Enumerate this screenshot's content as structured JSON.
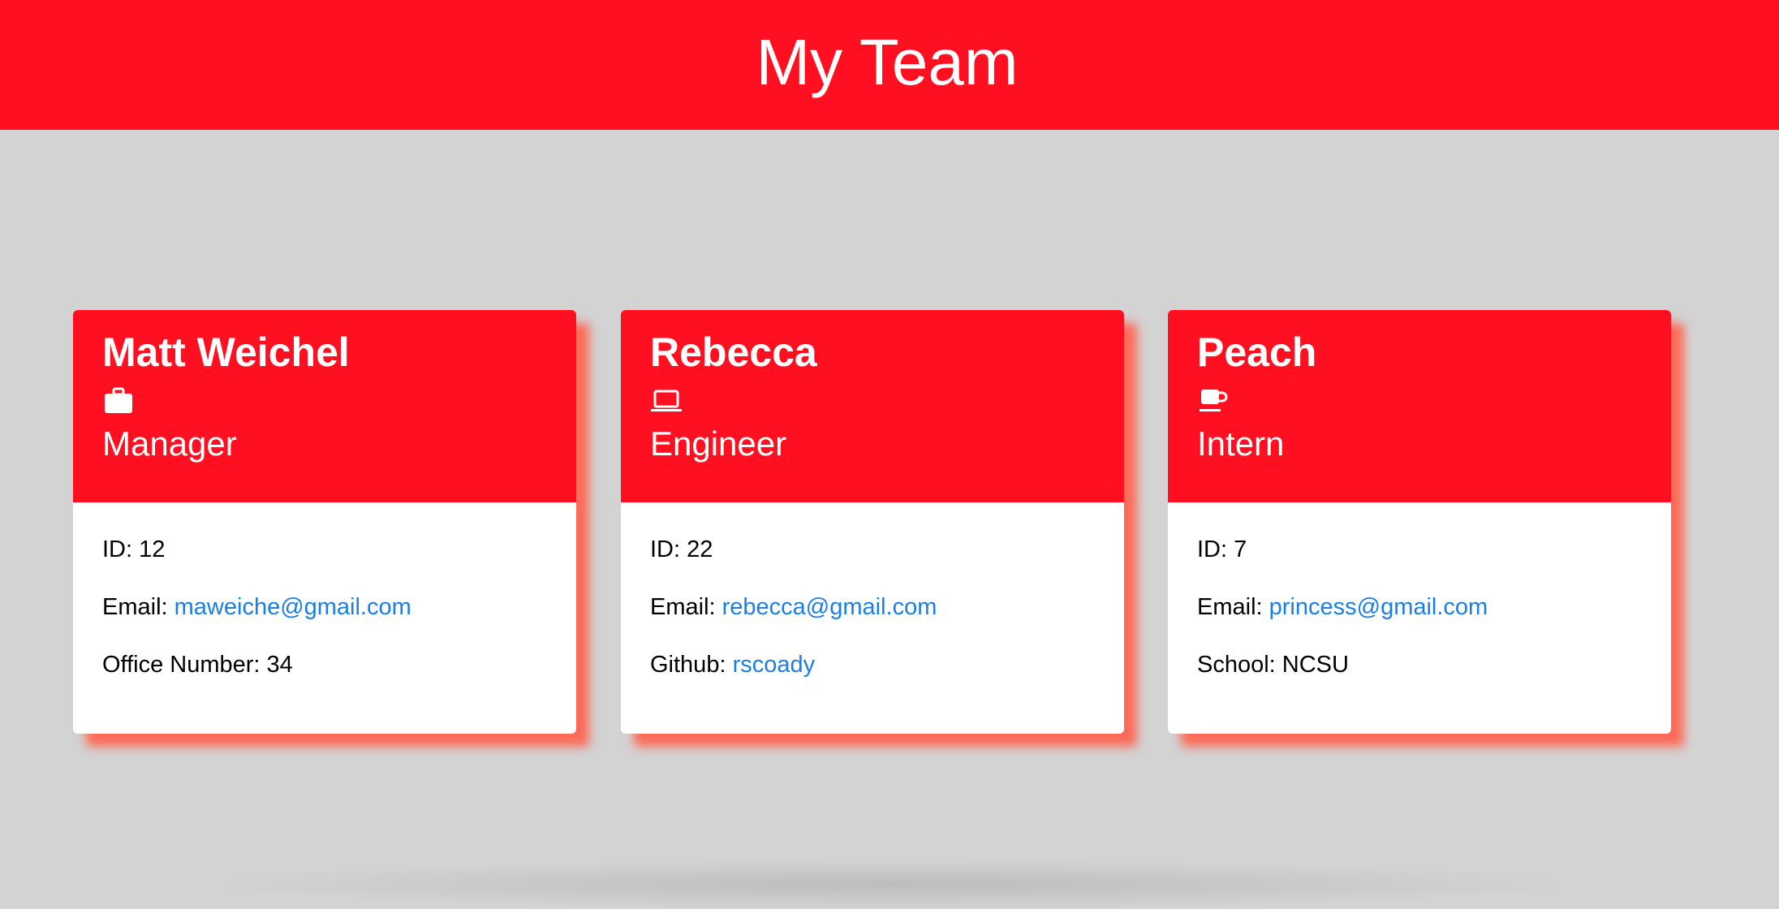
{
  "header": {
    "title": "My Team"
  },
  "colors": {
    "accent": "#ff0f1f",
    "link": "#1a7ee6",
    "background": "#d3d3d3",
    "shadow": "#ff6450"
  },
  "cards": [
    {
      "name": "Matt Weichel",
      "icon": "briefcase-icon",
      "role": "Manager",
      "id_label": "ID: ",
      "id_value": "12",
      "email_label": "Email: ",
      "email": "maweiche@gmail.com",
      "extra_label": "Office Number: ",
      "extra_value": "34"
    },
    {
      "name": "Rebecca",
      "icon": "laptop-icon",
      "role": "Engineer",
      "id_label": "ID: ",
      "id_value": "22",
      "email_label": "Email: ",
      "email": "rebecca@gmail.com",
      "extra_label": "Github: ",
      "extra_value": "rscoady"
    },
    {
      "name": "Peach",
      "icon": "mug-icon",
      "role": "Intern",
      "id_label": "ID: ",
      "id_value": "7",
      "email_label": "Email: ",
      "email": "princess@gmail.com",
      "extra_label": "School: ",
      "extra_value": "NCSU"
    }
  ]
}
